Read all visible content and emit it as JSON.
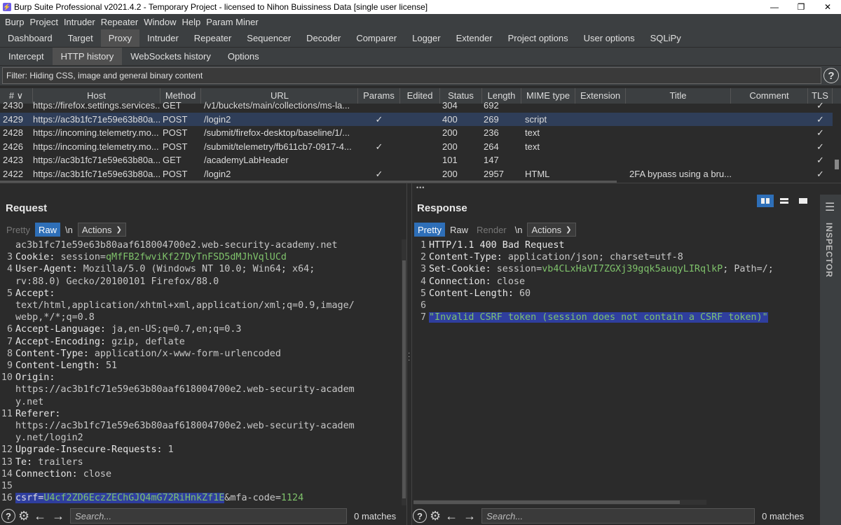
{
  "window": {
    "title": "Burp Suite Professional v2021.4.2 - Temporary Project - licensed to Nihon Buissiness Data [single user license]",
    "controls": [
      "—",
      "❐",
      "✕"
    ]
  },
  "menu": [
    "Burp",
    "Project",
    "Intruder",
    "Repeater",
    "Window",
    "Help",
    "Param Miner"
  ],
  "main_tabs": [
    {
      "label": "Dashboard",
      "active": false
    },
    {
      "label": "Target",
      "active": false
    },
    {
      "label": "Proxy",
      "active": true
    },
    {
      "label": "Intruder",
      "active": false
    },
    {
      "label": "Repeater",
      "active": false
    },
    {
      "label": "Sequencer",
      "active": false
    },
    {
      "label": "Decoder",
      "active": false
    },
    {
      "label": "Comparer",
      "active": false
    },
    {
      "label": "Logger",
      "active": false
    },
    {
      "label": "Extender",
      "active": false
    },
    {
      "label": "Project options",
      "active": false
    },
    {
      "label": "User options",
      "active": false
    },
    {
      "label": "SQLiPy",
      "active": false
    }
  ],
  "sub_tabs": [
    {
      "label": "Intercept",
      "active": false
    },
    {
      "label": "HTTP history",
      "active": true
    },
    {
      "label": "WebSockets history",
      "active": false
    },
    {
      "label": "Options",
      "active": false
    }
  ],
  "filter": {
    "text": "Filter: Hiding CSS, image and general binary content",
    "help": "?"
  },
  "history": {
    "columns": [
      "# ∨",
      "Host",
      "Method",
      "URL",
      "Params",
      "Edited",
      "Status",
      "Length",
      "MIME type",
      "Extension",
      "Title",
      "Comment",
      "TLS"
    ],
    "rows": [
      {
        "num": "2430",
        "host": "https://firefox.settings.services...",
        "method": "GET",
        "url": "/v1/buckets/main/collections/ms-la...",
        "params": "",
        "edited": "",
        "status": "304",
        "length": "692",
        "mime": "",
        "ext": "",
        "title": "",
        "comment": "",
        "tls": "✓",
        "selected": false
      },
      {
        "num": "2429",
        "host": "https://ac3b1fc71e59e63b80a...",
        "method": "POST",
        "url": "/login2",
        "params": "✓",
        "edited": "",
        "status": "400",
        "length": "269",
        "mime": "script",
        "ext": "",
        "title": "",
        "comment": "",
        "tls": "✓",
        "selected": true
      },
      {
        "num": "2428",
        "host": "https://incoming.telemetry.mo...",
        "method": "POST",
        "url": "/submit/firefox-desktop/baseline/1/...",
        "params": "",
        "edited": "",
        "status": "200",
        "length": "236",
        "mime": "text",
        "ext": "",
        "title": "",
        "comment": "",
        "tls": "✓",
        "selected": false
      },
      {
        "num": "2426",
        "host": "https://incoming.telemetry.mo...",
        "method": "POST",
        "url": "/submit/telemetry/fb611cb7-0917-4...",
        "params": "✓",
        "edited": "",
        "status": "200",
        "length": "264",
        "mime": "text",
        "ext": "",
        "title": "",
        "comment": "",
        "tls": "✓",
        "selected": false
      },
      {
        "num": "2423",
        "host": "https://ac3b1fc71e59e63b80a...",
        "method": "GET",
        "url": "/academyLabHeader",
        "params": "",
        "edited": "",
        "status": "101",
        "length": "147",
        "mime": "",
        "ext": "",
        "title": "",
        "comment": "",
        "tls": "✓",
        "selected": false
      },
      {
        "num": "2422",
        "host": "https://ac3b1fc71e59e63b80a...",
        "method": "POST",
        "url": "/login2",
        "params": "✓",
        "edited": "",
        "status": "200",
        "length": "2957",
        "mime": "HTML",
        "ext": "",
        "title": "2FA bypass using a bru...",
        "comment": "",
        "tls": "✓",
        "selected": false
      }
    ]
  },
  "request": {
    "title": "Request",
    "toolbar": {
      "pretty": "Pretty",
      "raw": "Raw",
      "newline": "\\n",
      "actions": "Actions"
    },
    "lines": [
      {
        "n": "",
        "parts": [
          {
            "t": "ac3b1fc71e59e63b80aaf618004700e2.web-security-academy.net",
            "c": "val"
          }
        ]
      },
      {
        "n": "3",
        "parts": [
          {
            "t": "Cookie: ",
            "c": "key"
          },
          {
            "t": "session=",
            "c": "val"
          },
          {
            "t": "qMfFB2fwviKf27DyTnFSD5dMJhVqlUCd",
            "c": "grn"
          }
        ]
      },
      {
        "n": "4",
        "parts": [
          {
            "t": "User-Agent: ",
            "c": "key"
          },
          {
            "t": "Mozilla/5.0 (Windows NT 10.0; Win64; x64;",
            "c": "val"
          }
        ]
      },
      {
        "n": "",
        "parts": [
          {
            "t": "rv:88.0) Gecko/20100101 Firefox/88.0",
            "c": "val"
          }
        ]
      },
      {
        "n": "5",
        "parts": [
          {
            "t": "Accept:",
            "c": "key"
          }
        ]
      },
      {
        "n": "",
        "parts": [
          {
            "t": "text/html,application/xhtml+xml,application/xml;q=0.9,image/",
            "c": "val"
          }
        ]
      },
      {
        "n": "",
        "parts": [
          {
            "t": "webp,*/*;q=0.8",
            "c": "val"
          }
        ]
      },
      {
        "n": "6",
        "parts": [
          {
            "t": "Accept-Language: ",
            "c": "key"
          },
          {
            "t": "ja,en-US;q=0.7,en;q=0.3",
            "c": "val"
          }
        ]
      },
      {
        "n": "7",
        "parts": [
          {
            "t": "Accept-Encoding: ",
            "c": "key"
          },
          {
            "t": "gzip, deflate",
            "c": "val"
          }
        ]
      },
      {
        "n": "8",
        "parts": [
          {
            "t": "Content-Type: ",
            "c": "key"
          },
          {
            "t": "application/x-www-form-urlencoded",
            "c": "val"
          }
        ]
      },
      {
        "n": "9",
        "parts": [
          {
            "t": "Content-Length: ",
            "c": "key"
          },
          {
            "t": "51",
            "c": "val"
          }
        ]
      },
      {
        "n": "10",
        "parts": [
          {
            "t": "Origin:",
            "c": "key"
          }
        ]
      },
      {
        "n": "",
        "parts": [
          {
            "t": "https://ac3b1fc71e59e63b80aaf618004700e2.web-security-academ",
            "c": "val"
          }
        ]
      },
      {
        "n": "",
        "parts": [
          {
            "t": "y.net",
            "c": "val"
          }
        ]
      },
      {
        "n": "11",
        "parts": [
          {
            "t": "Referer:",
            "c": "key"
          }
        ]
      },
      {
        "n": "",
        "parts": [
          {
            "t": "https://ac3b1fc71e59e63b80aaf618004700e2.web-security-academ",
            "c": "val"
          }
        ]
      },
      {
        "n": "",
        "parts": [
          {
            "t": "y.net/login2",
            "c": "val"
          }
        ]
      },
      {
        "n": "12",
        "parts": [
          {
            "t": "Upgrade-Insecure-Requests: ",
            "c": "key"
          },
          {
            "t": "1",
            "c": "val"
          }
        ]
      },
      {
        "n": "13",
        "parts": [
          {
            "t": "Te: ",
            "c": "key"
          },
          {
            "t": "trailers",
            "c": "val"
          }
        ]
      },
      {
        "n": "14",
        "parts": [
          {
            "t": "Connection: ",
            "c": "key"
          },
          {
            "t": "close",
            "c": "val"
          }
        ]
      },
      {
        "n": "15",
        "parts": []
      },
      {
        "n": "16",
        "parts": [
          {
            "t": "csrf=",
            "c": "hl"
          },
          {
            "t": "U4cf2ZD6EczZEChGJQ4mG72RiHnkZf1E",
            "c": "hlstr"
          },
          {
            "t": "&mfa-code=",
            "c": "val"
          },
          {
            "t": "1124",
            "c": "grn"
          }
        ]
      }
    ],
    "search_placeholder": "Search...",
    "matches": "0 matches"
  },
  "response": {
    "title": "Response",
    "toolbar": {
      "pretty": "Pretty",
      "raw": "Raw",
      "render": "Render",
      "newline": "\\n",
      "actions": "Actions"
    },
    "lines": [
      {
        "n": "1",
        "parts": [
          {
            "t": "HTTP/1.1 400 Bad Request",
            "c": "key"
          }
        ]
      },
      {
        "n": "2",
        "parts": [
          {
            "t": "Content-Type: ",
            "c": "key"
          },
          {
            "t": "application/json; charset=utf-8",
            "c": "val"
          }
        ]
      },
      {
        "n": "3",
        "parts": [
          {
            "t": "Set-Cookie: ",
            "c": "key"
          },
          {
            "t": "session=",
            "c": "val"
          },
          {
            "t": "vb4CLxHaVI7ZGXj39gqk5auqyLIRqlkP",
            "c": "grn"
          },
          {
            "t": "; Path=/;",
            "c": "val"
          }
        ]
      },
      {
        "n": "4",
        "parts": [
          {
            "t": "Connection: ",
            "c": "key"
          },
          {
            "t": "close",
            "c": "val"
          }
        ]
      },
      {
        "n": "5",
        "parts": [
          {
            "t": "Content-Length: ",
            "c": "key"
          },
          {
            "t": "60",
            "c": "val"
          }
        ]
      },
      {
        "n": "6",
        "parts": []
      },
      {
        "n": "7",
        "parts": [
          {
            "t": "\"Invalid CSRF token (session does not contain a CSRF token)\"",
            "c": "hlstr"
          }
        ]
      }
    ],
    "search_placeholder": "Search...",
    "matches": "0 matches"
  },
  "inspector": {
    "label": "INSPECTOR"
  },
  "colors": {
    "accent": "#2e6fb8",
    "selected_row": "#2f3e59",
    "green_value": "#7fc26b",
    "highlight": "#2f3e9e"
  }
}
